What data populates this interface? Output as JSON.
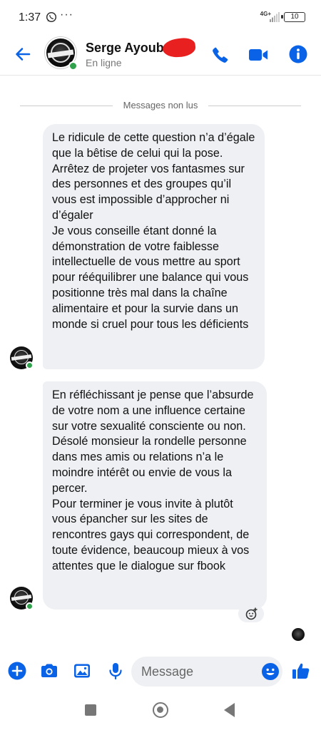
{
  "status_bar": {
    "time": "1:37",
    "more": "···",
    "network": "4G+",
    "battery": "10"
  },
  "header": {
    "contact_name": "Serge Ayoub",
    "contact_status": "En ligne"
  },
  "conversation": {
    "unread_divider": "Messages non lus",
    "messages": [
      {
        "sender": "contact",
        "text": "Le ridicule de cette question n’a d’égale que la bêtise de celui qui la pose.\nArrêtez de projeter vos fantasmes sur des personnes et des groupes qu’il vous est impossible d’approcher ni d’égaler\nJe vous conseille étant donné la démonstration de votre faiblesse intellectuelle de vous mettre au sport pour rééquilibrer une balance qui vous positionne très mal dans la chaîne alimentaire et pour la survie dans un monde si cruel pour tous les déficients"
      },
      {
        "sender": "contact",
        "text": "En réfléchissant je pense que l’absurde de votre nom a une influence certaine sur votre sexualité consciente ou non.\nDésolé monsieur la rondelle personne dans mes amis ou relations n’a le moindre intérêt ou envie de vous la percer.\nPour terminer je vous invite à plutôt vous épancher sur les sites de rencontres gays qui correspondent, de toute évidence, beaucoup mieux à vos attentes que le dialogue sur fbook"
      }
    ]
  },
  "composer": {
    "placeholder": "Message"
  },
  "colors": {
    "accent": "#0a62e6",
    "online": "#31a24c",
    "bubble": "#eef0f3"
  },
  "icons": {
    "back": "arrow-left-icon",
    "call": "phone-icon",
    "video": "video-camera-icon",
    "info": "info-icon",
    "add": "plus-circle-icon",
    "camera": "camera-icon",
    "gallery": "image-icon",
    "mic": "microphone-icon",
    "emoji": "smiley-icon",
    "like": "thumbs-up-icon"
  }
}
